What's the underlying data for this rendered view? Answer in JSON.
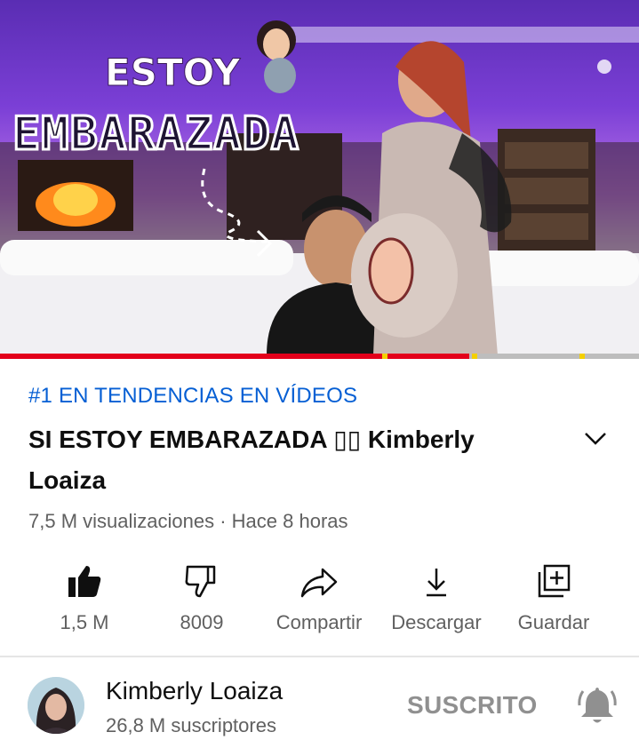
{
  "video": {
    "thumbnail_text_top": "ESTOY",
    "thumbnail_text_bottom": "EMBARAZADA",
    "progress_fraction": 0.735,
    "trending_label": "#1 EN TENDENCIAS EN VÍDEOS",
    "title_line1": "SI ESTOY EMBARAZADA ▯▯  Kimberly",
    "title_line2": "Loaiza",
    "views": "7,5 M visualizaciones",
    "separator": " · ",
    "age": "Hace 8 horas"
  },
  "actions": {
    "like": {
      "label": "1,5 M",
      "icon": "thumbs-up-filled-icon"
    },
    "dislike": {
      "label": "8009",
      "icon": "thumbs-down-icon"
    },
    "share": {
      "label": "Compartir",
      "icon": "share-arrow-icon"
    },
    "download": {
      "label": "Descargar",
      "icon": "download-icon"
    },
    "save": {
      "label": "Guardar",
      "icon": "add-to-playlist-icon"
    }
  },
  "channel": {
    "name": "Kimberly Loaiza",
    "subscribers": "26,8 M suscriptores",
    "subscribe_state": "SUSCRITO",
    "bell_icon": "notification-bell-icon"
  },
  "colors": {
    "trending": "#065fd4",
    "progress": "#e3001b",
    "ad_marker": "#f4d000",
    "secondary_text": "#606060"
  }
}
